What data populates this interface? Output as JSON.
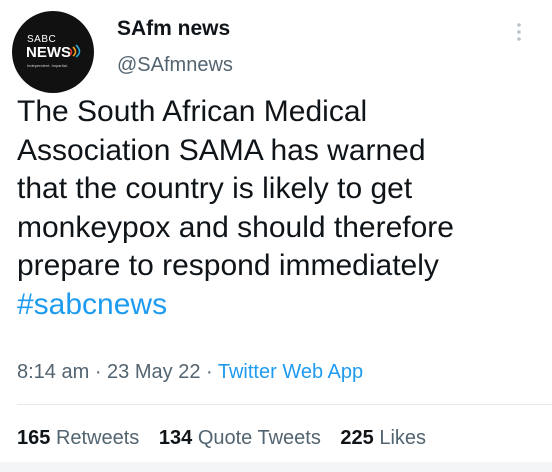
{
  "avatar": {
    "logo_small": "SABC",
    "logo_main": "NEWS",
    "logo_tag": "Independent. Impartial.",
    "icon": "sabc-news-logo-icon"
  },
  "author": {
    "name": "SAfm news",
    "handle": "@SAfmnews"
  },
  "menu_icon": "more-vertical-icon",
  "tweet": {
    "lines": [
      "The South African Medical",
      "Association SAMA has warned",
      "that the country is likely to get",
      "monkeypox and should therefore",
      "prepare to respond immediately"
    ],
    "hashtag": "#sabcnews"
  },
  "meta": {
    "time": "8:14 am",
    "sep1": " · ",
    "date": "23 May 22",
    "sep2": " · ",
    "source": "Twitter Web App"
  },
  "stats": {
    "retweets_count": "165",
    "retweets_label": "Retweets",
    "quotes_count": "134",
    "quotes_label": "Quote Tweets",
    "likes_count": "225",
    "likes_label": "Likes"
  },
  "colors": {
    "link": "#1d9bf0",
    "secondary_text": "#536471",
    "primary_text": "#0f1419",
    "avatar_bg": "#111111"
  }
}
